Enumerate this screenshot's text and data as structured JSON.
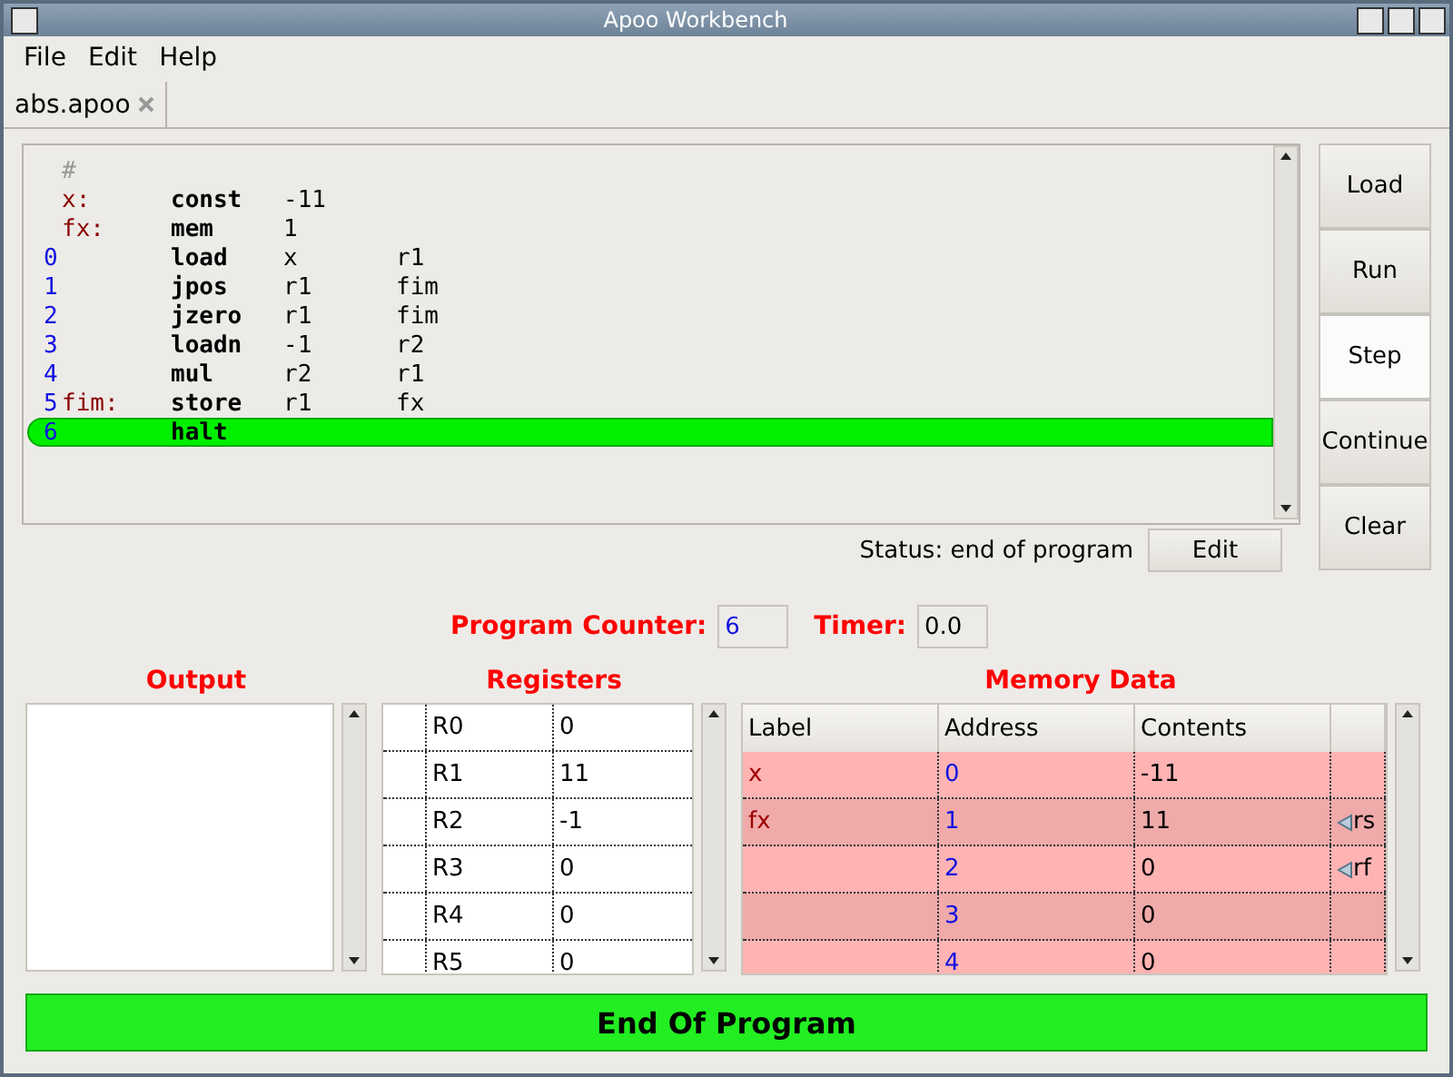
{
  "window": {
    "title": "Apoo Workbench"
  },
  "menu": [
    "File",
    "Edit",
    "Help"
  ],
  "tabs": [
    {
      "label": "abs.apoo",
      "selected": true
    }
  ],
  "code": [
    {
      "kind": "comment",
      "text": "#"
    },
    {
      "kind": "instr",
      "label": "x:",
      "op": "const",
      "a1": "-11",
      "current": false
    },
    {
      "kind": "instr",
      "label": "fx:",
      "op": "mem",
      "a1": "1",
      "current": false
    },
    {
      "kind": "instr",
      "num": "0",
      "op": "load",
      "a1": "x",
      "a2": "r1",
      "current": false
    },
    {
      "kind": "instr",
      "num": "1",
      "op": "jpos",
      "a1": "r1",
      "a2": "fim",
      "current": false
    },
    {
      "kind": "instr",
      "num": "2",
      "op": "jzero",
      "a1": "r1",
      "a2": "fim",
      "current": false
    },
    {
      "kind": "instr",
      "num": "3",
      "op": "loadn",
      "a1": "-1",
      "a2": "r2",
      "current": false
    },
    {
      "kind": "instr",
      "num": "4",
      "op": "mul",
      "a1": "r2",
      "a2": "r1",
      "current": false
    },
    {
      "kind": "instr",
      "num": "5",
      "label": "fim:",
      "op": "store",
      "a1": "r1",
      "a2": "fx",
      "current": false
    },
    {
      "kind": "instr",
      "num": "6",
      "op": "halt",
      "current": true
    }
  ],
  "actions": [
    {
      "label": "Load",
      "focused": false
    },
    {
      "label": "Run",
      "focused": false
    },
    {
      "label": "Step",
      "focused": true
    },
    {
      "label": "Continue",
      "focused": false
    },
    {
      "label": "Clear",
      "focused": false
    }
  ],
  "status": {
    "text": "Status: end of program",
    "edit_button": "Edit"
  },
  "program_counter": {
    "label": "Program Counter:",
    "value": "6"
  },
  "timer": {
    "label": "Timer:",
    "value": "0.0"
  },
  "output": {
    "title": "Output"
  },
  "registers": {
    "title": "Registers",
    "rows": [
      {
        "name": "R0",
        "value": "0"
      },
      {
        "name": "R1",
        "value": "11"
      },
      {
        "name": "R2",
        "value": "-1"
      },
      {
        "name": "R3",
        "value": "0"
      },
      {
        "name": "R4",
        "value": "0"
      },
      {
        "name": "R5",
        "value": "0"
      }
    ]
  },
  "memory": {
    "title": "Memory Data",
    "columns": [
      "Label",
      "Address",
      "Contents"
    ],
    "rows": [
      {
        "label": "x",
        "address": "0",
        "contents": "-11"
      },
      {
        "label": "fx",
        "address": "1",
        "contents": "11",
        "pointer": "rs"
      },
      {
        "address": "2",
        "contents": "0",
        "pointer": "rf"
      },
      {
        "address": "3",
        "contents": "0"
      },
      {
        "address": "4",
        "contents": "0"
      }
    ]
  },
  "banner": "End Of Program"
}
